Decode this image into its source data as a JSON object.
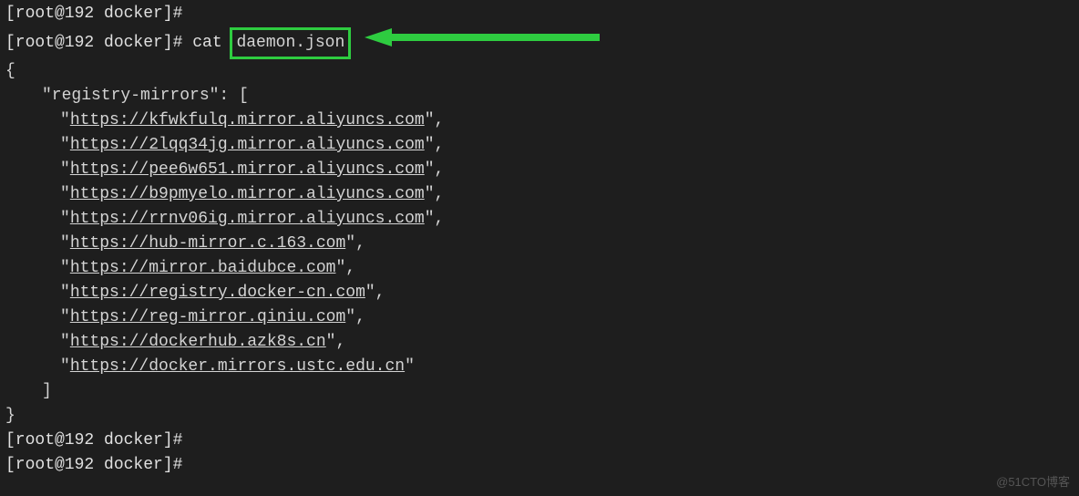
{
  "prompts": {
    "line1": "[root@192 docker]#",
    "line2_prefix": "[root@192 docker]# cat",
    "line2_file": "daemon.json",
    "end1": "[root@192 docker]#",
    "end2": "[root@192 docker]#"
  },
  "json_output": {
    "open_brace": "{",
    "key_label": "\"registry-mirrors\": [",
    "mirrors": [
      "https://kfwkfulq.mirror.aliyuncs.com",
      "https://2lqq34jg.mirror.aliyuncs.com",
      "https://pee6w651.mirror.aliyuncs.com",
      "https://b9pmyelo.mirror.aliyuncs.com",
      "https://rrnv06ig.mirror.aliyuncs.com",
      "https://hub-mirror.c.163.com",
      "https://mirror.baidubce.com",
      "https://registry.docker-cn.com",
      "https://reg-mirror.qiniu.com",
      "https://dockerhub.azk8s.cn",
      "https://docker.mirrors.ustc.edu.cn"
    ],
    "close_bracket": "]",
    "close_brace": "}"
  },
  "watermark": "@51CTO博客"
}
